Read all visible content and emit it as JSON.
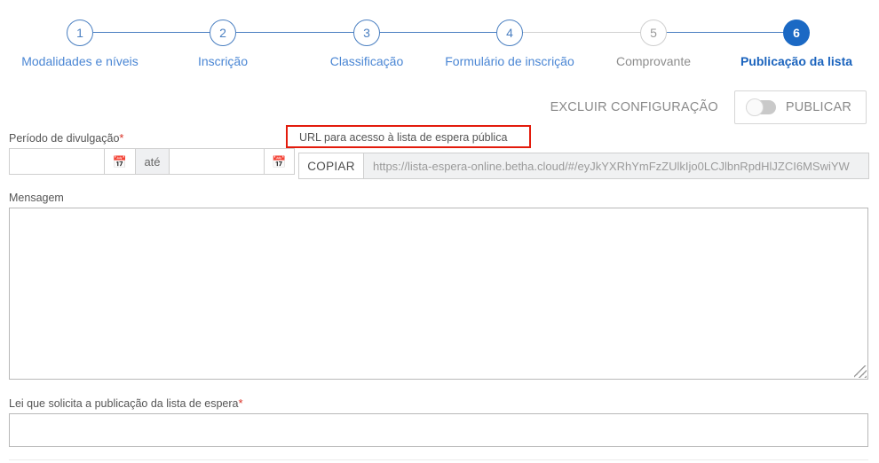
{
  "stepper": {
    "steps": [
      {
        "number": "1",
        "label": "Modalidades e níveis",
        "state": "link"
      },
      {
        "number": "2",
        "label": "Inscrição",
        "state": "link"
      },
      {
        "number": "3",
        "label": "Classificação",
        "state": "link"
      },
      {
        "number": "4",
        "label": "Formulário de inscrição",
        "state": "link"
      },
      {
        "number": "5",
        "label": "Comprovante",
        "state": "inactive"
      },
      {
        "number": "6",
        "label": "Publicação da lista",
        "state": "current"
      }
    ]
  },
  "publish_row": {
    "excluir_label": "EXCLUIR CONFIGURAÇÃO",
    "toggle_label": "PUBLICAR",
    "toggle_state": "off"
  },
  "periodo": {
    "label": "Período de divulgação",
    "required_mark": "*",
    "start_value": "",
    "end_value": "",
    "separator": "até",
    "calendar_icon": "calendar-icon"
  },
  "url": {
    "label": "URL para acesso à lista de espera pública",
    "copy_button": "COPIAR",
    "value": "https://lista-espera-online.betha.cloud/#/eyJkYXRhYmFzZUlkIjo0LCJlbnRpdHlJZCI6MSwiYW"
  },
  "mensagem": {
    "label": "Mensagem",
    "value": ""
  },
  "lei": {
    "label": "Lei que solicita a publicação da lista de espera",
    "required_mark": "*",
    "value": ""
  },
  "colors": {
    "accent_blue": "#1b69c4",
    "link_blue": "#4a86d4",
    "annotation_red": "#e31b0c",
    "required_red": "#d93025",
    "muted_gray": "#8a8a8a"
  }
}
